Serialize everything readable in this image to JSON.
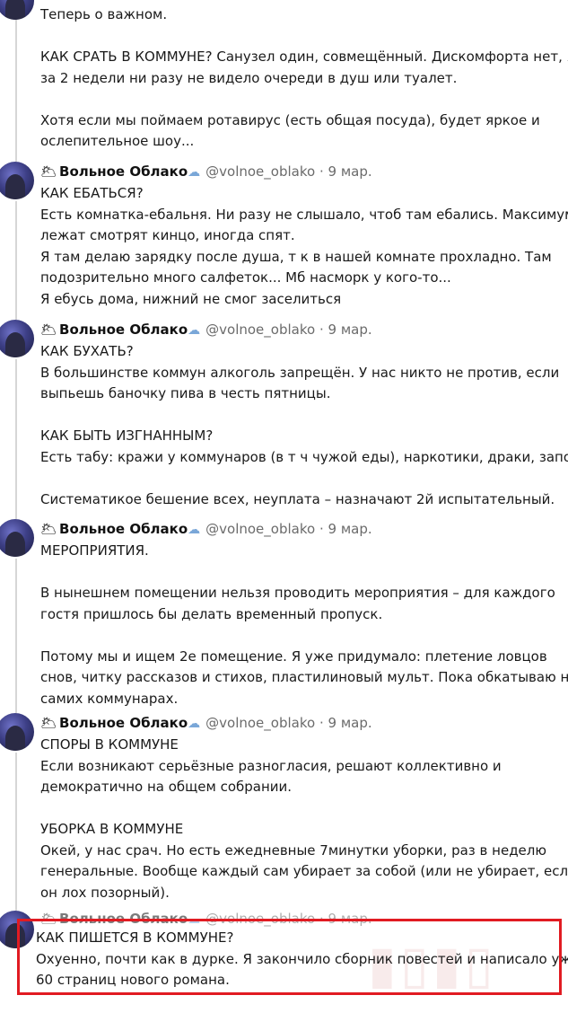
{
  "author": {
    "name": "Вольное Облако",
    "handle": "@volnoe_oblako",
    "separator": "·",
    "date": "9 мар.",
    "name_emoji": "🌥",
    "cloud_emoji": "☁"
  },
  "tweet0": {
    "lines": [
      "Теперь о важном.",
      "",
      "КАК СРАТЬ В КОММУНЕ? Санузел один, совмещённый. Дискомфорта нет, я",
      "за 2 недели ни разу не видело очереди в душ или туалет.",
      "",
      "Хотя если мы поймаем ротавирус (есть общая посуда), будет яркое и",
      "ослепительное шоу..."
    ]
  },
  "tweet1": {
    "lines": [
      "КАК ЕБАТЬСЯ?",
      "Есть комнатка-ебальня. Ни разу не слышало, чтоб там ебались. Максимум",
      "лежат смотрят кинцо, иногда спят.",
      "Я там делаю зарядку после душа, т к в нашей комнате прохладно. Там",
      "подозрительно много салфеток... Мб насморк у кого-то...",
      "Я ебусь дома, нижний не смог заселиться"
    ]
  },
  "tweet2": {
    "lines": [
      "КАК БУХАТЬ?",
      "В большинстве коммун алкоголь запрещён. У нас никто не против, если",
      "выпьешь баночку пива в честь пятницы.",
      "",
      "КАК БЫТЬ ИЗГНАННЫМ?",
      "Есть  табу: кражи у коммунаров (в т ч чужой еды), наркотики, драки, запои.",
      "",
      "Систематикое бешение всех, неуплата – назначают 2й испытательный."
    ]
  },
  "tweet3": {
    "lines": [
      "МЕРОПРИЯТИЯ.",
      "",
      "В нынешнем помещении нельзя проводить мероприятия – для каждого",
      "гостя пришлось бы делать временный пропуск.",
      "",
      "Потому мы и ищем 2е помещение. Я уже придумало: плетение ловцов",
      "снов, читку рассказов и стихов, пластилиновый мульт. Пока обкатываю на",
      "самих коммунарах."
    ]
  },
  "tweet4": {
    "lines": [
      "СПОРЫ В КОММУНЕ",
      "Если возникают серьёзные разногласия, решают коллективно и",
      "демократично на общем собрании.",
      "",
      "УБОРКА В КОММУНЕ",
      "Окей, у нас срач. Но  есть ежедневные 7минутки уборки, раз в неделю",
      "генеральные. Вообще каждый сам убирает за собой (или не убирает, если",
      "он лох позорный)."
    ]
  },
  "tweet5": {
    "lines": [
      "КАК ПИШЕТСЯ В КОММУНЕ?",
      "Охуенно, почти как в дурке. Я закончило сборник повестей и написало уже",
      "60 страниц нового романа."
    ]
  },
  "accent_color": "#e11b22"
}
